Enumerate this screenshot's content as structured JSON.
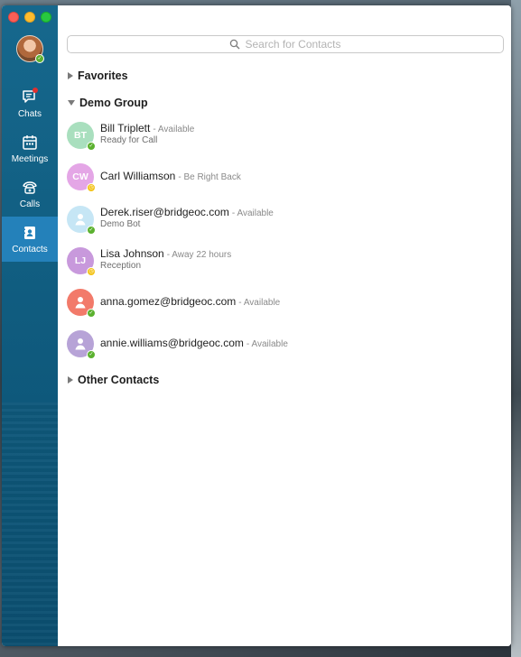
{
  "colors": {
    "sidebar": "#0f5a7d",
    "sidebar_active": "#2481ba",
    "available": "#5bb12f",
    "away": "#f3c318"
  },
  "sidebar": {
    "nav": [
      {
        "id": "chats",
        "label": "Chats",
        "icon": "chat-icon",
        "has_badge": true
      },
      {
        "id": "meetings",
        "label": "Meetings",
        "icon": "calendar-icon"
      },
      {
        "id": "calls",
        "label": "Calls",
        "icon": "phone-icon"
      },
      {
        "id": "contacts",
        "label": "Contacts",
        "icon": "address-book-icon",
        "active": true
      }
    ]
  },
  "search": {
    "placeholder": "Search for Contacts",
    "icon": "search-icon"
  },
  "groups": {
    "favorites": "Favorites",
    "demo": "Demo Group",
    "other": "Other Contacts"
  },
  "contacts": [
    {
      "name": "Bill Triplett",
      "status": "- Available",
      "note": "Ready for Call",
      "initials": "BT",
      "color": "#a9dfbe",
      "presence": "available"
    },
    {
      "name": "Carl Williamson",
      "status": "- Be Right Back",
      "note": "",
      "initials": "CW",
      "color": "#e4a6e6",
      "presence": "away"
    },
    {
      "name": "Derek.riser@bridgeoc.com",
      "status": "- Available",
      "note": "Demo Bot",
      "initials": "",
      "color": "#c6e6f5",
      "presence": "available"
    },
    {
      "name": "Lisa Johnson",
      "status": "- Away 22 hours",
      "note": "Reception",
      "initials": "LJ",
      "color": "#c899dc",
      "presence": "away"
    },
    {
      "name": "anna.gomez@bridgeoc.com",
      "status": "- Available",
      "note": "",
      "initials": "",
      "color": "#f27a6a",
      "presence": "available"
    },
    {
      "name": "annie.williams@bridgeoc.com",
      "status": "- Available",
      "note": "",
      "initials": "",
      "color": "#b7a3d7",
      "presence": "available"
    }
  ]
}
